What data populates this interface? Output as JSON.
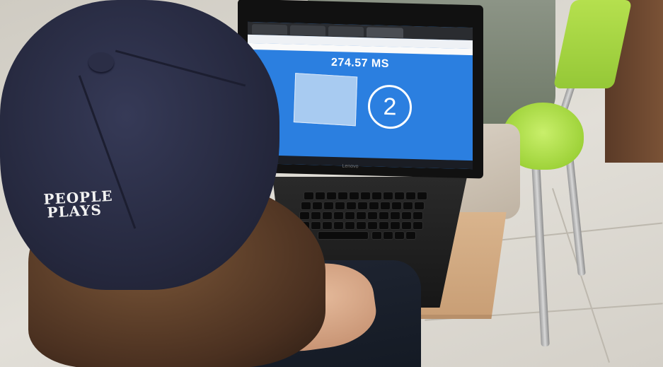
{
  "screen": {
    "reaction_time": "274.57 MS",
    "countdown": "2",
    "brand": "Lenovo"
  },
  "cap": {
    "logo_line1": "PEOPLE",
    "logo_line2": "PLAYS"
  },
  "colors": {
    "screen_blue": "#2b7fe0",
    "cap_navy": "#26293f",
    "chair_green": "#a6dc43",
    "table_wood": "#d2aa82"
  }
}
